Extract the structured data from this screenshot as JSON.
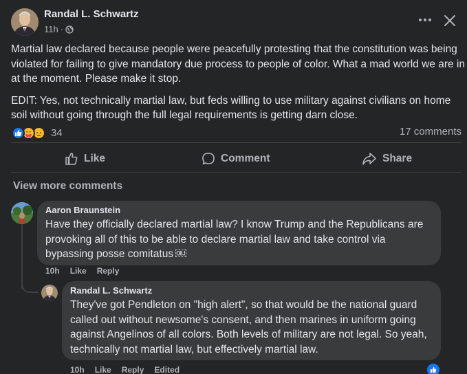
{
  "post": {
    "author": "Randal L. Schwartz",
    "time": "11h",
    "privacy_icon": "globe-icon",
    "paragraph1": "Martial law declared because people were peacefully protesting that the constitution was being violated for failing to give mandatory due process to people of color. What a mad world we are in at the moment. Please make it stop.",
    "paragraph2": "EDIT:  Yes, not technically martial law, but feds willing to use military against civilians on home soil without going through the full legal requirements is getting darn close.",
    "reaction_icons": [
      "like-icon",
      "care-icon",
      "sad-icon"
    ],
    "reaction_count": "34",
    "comment_count": "17 comments"
  },
  "actions": {
    "like": "Like",
    "comment": "Comment",
    "share": "Share"
  },
  "view_more": "View more comments",
  "comments": [
    {
      "author": "Aaron Braunstein",
      "text": "Have they officially declared martial law? I know Trump and the Republicans are provoking all of this to be able to declare martial law and take control via bypassing posse comitatus ￼",
      "time": "10h",
      "like": "Like",
      "reply": "Reply"
    },
    {
      "author": "Randal L. Schwartz",
      "text": "They've got Pendleton on \"high alert\", so that would be the national guard called out without newsome's consent, and then marines in uniform going against Angelinos of all colors. Both levels of military are not legal. So yeah, technically not martial law, but effectively martial law.",
      "time": "10h",
      "like": "Like",
      "reply": "Reply",
      "edited": "Edited"
    }
  ],
  "colors": {
    "background": "#242526",
    "bubble": "#3a3b3c",
    "text_primary": "#e4e6eb",
    "text_secondary": "#b0b3b8",
    "like_blue": "#1877f2"
  }
}
